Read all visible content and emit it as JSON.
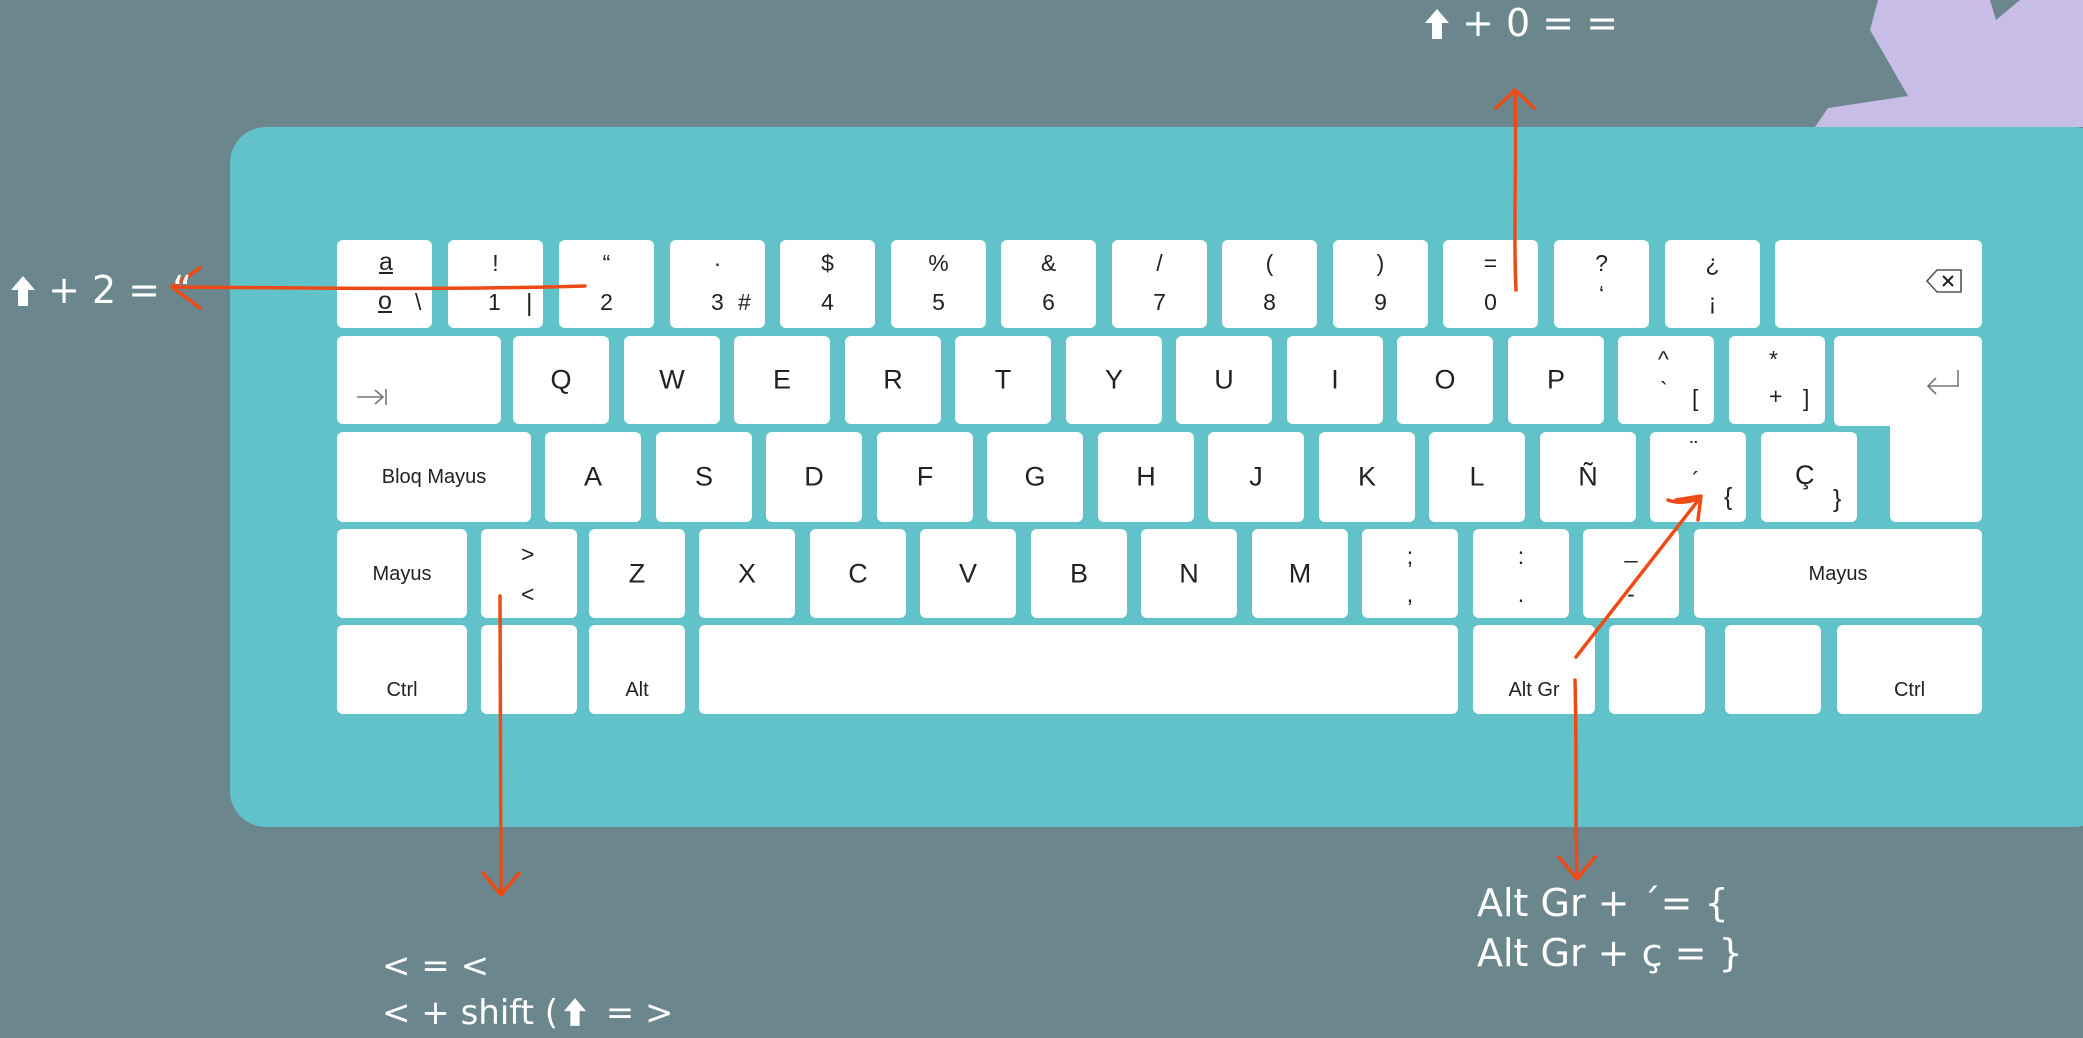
{
  "colors": {
    "background": "#6b868c",
    "keyboard": "#62c2c9",
    "key": "#ffffff",
    "arrow": "#ee4a15",
    "note_text": "#ffffff",
    "gear": "#c7bde6"
  },
  "keyboard": {
    "row1": [
      {
        "up": "a",
        "low": "o",
        "alt": "\\"
      },
      {
        "up": "!",
        "low": "1",
        "alt": "|"
      },
      {
        "up": "“",
        "low": "2",
        "alt": ""
      },
      {
        "up": "·",
        "low": "3",
        "alt": "#"
      },
      {
        "up": "$",
        "low": "4",
        "alt": ""
      },
      {
        "up": "%",
        "low": "5",
        "alt": ""
      },
      {
        "up": "&",
        "low": "6",
        "alt": ""
      },
      {
        "up": "/",
        "low": "7",
        "alt": ""
      },
      {
        "up": "(",
        "low": "8",
        "alt": ""
      },
      {
        "up": ")",
        "low": "9",
        "alt": ""
      },
      {
        "up": "=",
        "low": "0",
        "alt": ""
      },
      {
        "up": "?",
        "low": "‘",
        "alt": ""
      },
      {
        "up": "¿",
        "low": "¡",
        "alt": ""
      }
    ],
    "backspace_icon": "backspace-icon",
    "row2": [
      "Q",
      "W",
      "E",
      "R",
      "T",
      "Y",
      "U",
      "I",
      "O",
      "P"
    ],
    "row2_extra": [
      {
        "up": "^",
        "low": "`",
        "alt": "["
      },
      {
        "up": "*",
        "low": "+",
        "alt": "]"
      }
    ],
    "tab_icon": "tab-icon",
    "enter_icon": "enter-icon",
    "caps_label": "Bloq Mayus",
    "row3": [
      "A",
      "S",
      "D",
      "F",
      "G",
      "H",
      "J",
      "K",
      "L",
      "Ñ"
    ],
    "row3_extra": [
      {
        "up": "¨",
        "low": "´",
        "alt": "{"
      },
      {
        "up": "",
        "low": "Ç",
        "alt": "}"
      }
    ],
    "shift_left_label": "Mayus",
    "angle_key": {
      "up": ">",
      "low": "<"
    },
    "row4": [
      "Z",
      "X",
      "C",
      "V",
      "B",
      "N",
      "M"
    ],
    "row4_extra": [
      {
        "up": ";",
        "low": ","
      },
      {
        "up": ":",
        "low": "."
      },
      {
        "up": "_",
        "low": "-"
      }
    ],
    "shift_right_label": "Mayus",
    "ctrl_left_label": "Ctrl",
    "alt_label": "Alt",
    "altgr_label": "Alt Gr",
    "ctrl_right_label": "Ctrl"
  },
  "annotations": {
    "zero_note": "+ 0 = =",
    "two_note": "+ 2 = “",
    "angle_line1": "< = <",
    "angle_line2": "< + shift (",
    "angle_line2_end": "= >",
    "altgr_line1": "Alt Gr + ´= {",
    "altgr_line2": "Alt Gr + ç = }",
    "shift_icon": "shift-arrow-icon"
  }
}
